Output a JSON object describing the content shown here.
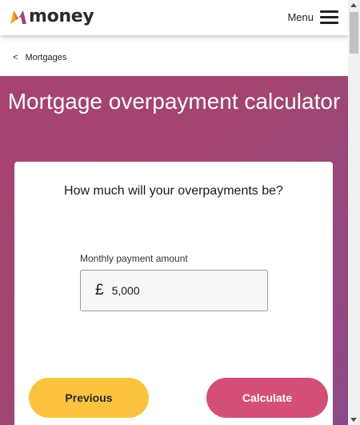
{
  "header": {
    "logo_text": "money",
    "logo_icon": "money-logo-mark-icon",
    "menu_label": "Menu",
    "menu_icon": "hamburger-icon"
  },
  "breadcrumb": {
    "chevron": "<",
    "label": "Mortgages"
  },
  "hero": {
    "title": "Mortgage overpayment calculator"
  },
  "form": {
    "question": "How much will your overpayments be?",
    "field_label": "Monthly payment amount",
    "currency_symbol": "£",
    "amount_value": "5,000"
  },
  "actions": {
    "previous_label": "Previous",
    "calculate_label": "Calculate"
  },
  "colors": {
    "hero_gradient_start": "#a84270",
    "hero_gradient_end": "#8a4a8a",
    "previous_button": "#fcc33f",
    "calculate_button": "#d34f77",
    "logo_orange": "#f5a623",
    "logo_purple": "#a3457a"
  }
}
